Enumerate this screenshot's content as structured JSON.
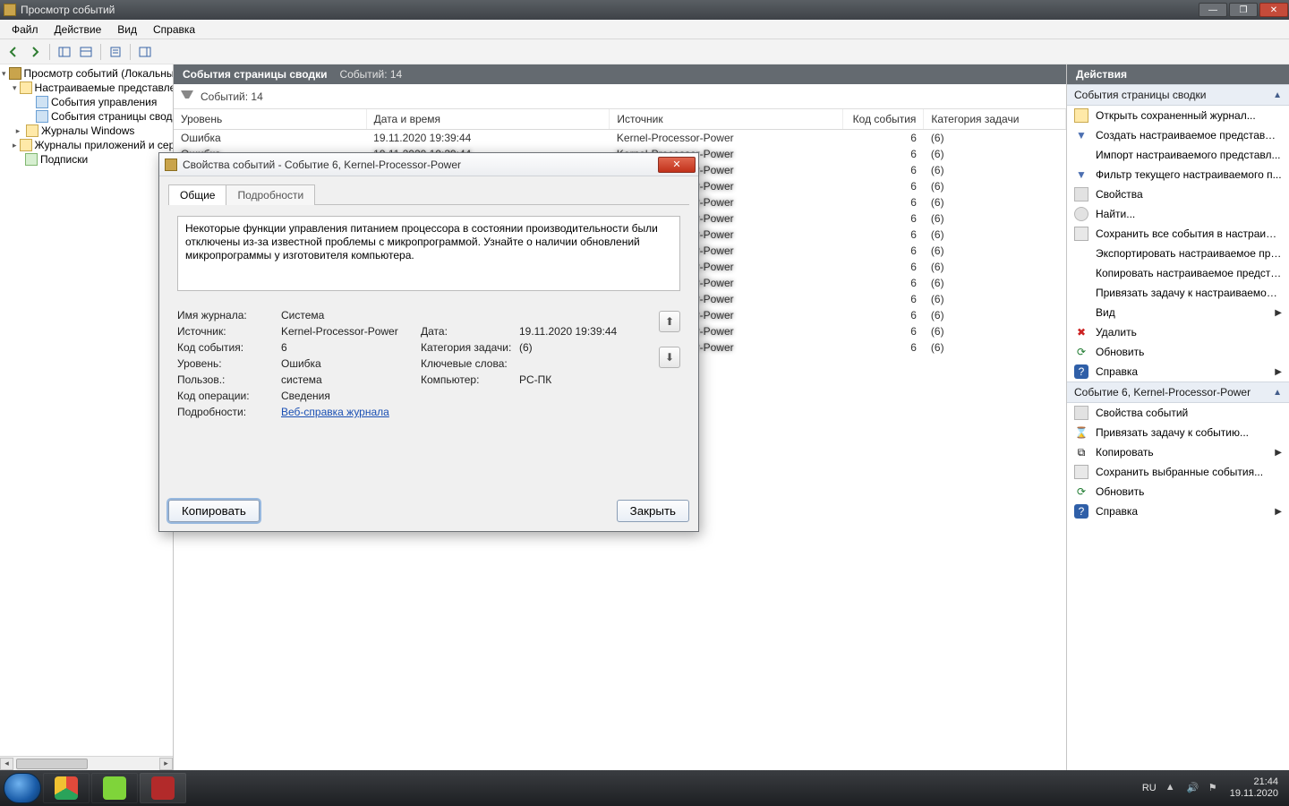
{
  "window": {
    "title": "Просмотр событий"
  },
  "menus": {
    "file": "Файл",
    "action": "Действие",
    "view": "Вид",
    "help": "Справка"
  },
  "tree": {
    "root": "Просмотр событий (Локальный)",
    "custom_views": "Настраиваемые представления",
    "admin_events": "События управления",
    "summary_events": "События страницы сводки",
    "windows_logs": "Журналы Windows",
    "app_logs": "Журналы приложений и сервисов",
    "subscriptions": "Подписки"
  },
  "center": {
    "section_title": "События страницы сводки",
    "events_count_hdr": "Событий: 14",
    "filter_label": "Событий: 14",
    "columns": {
      "level": "Уровень",
      "date": "Дата и время",
      "source": "Источник",
      "code": "Код события",
      "category": "Категория задачи"
    },
    "rows": [
      {
        "level": "Ошибка",
        "date": "19.11.2020 19:39:44",
        "source": "Kernel-Processor-Power",
        "code": "6",
        "category": "(6)"
      },
      {
        "level": "",
        "date": "",
        "source": "",
        "code": "6",
        "category": "(6)"
      },
      {
        "level": "",
        "date": "",
        "source": "",
        "code": "6",
        "category": "(6)"
      },
      {
        "level": "",
        "date": "",
        "source": "",
        "code": "6",
        "category": "(6)"
      },
      {
        "level": "",
        "date": "",
        "source": "",
        "code": "6",
        "category": "(6)"
      },
      {
        "level": "",
        "date": "",
        "source": "",
        "code": "6",
        "category": "(6)"
      },
      {
        "level": "",
        "date": "",
        "source": "",
        "code": "6",
        "category": "(6)"
      },
      {
        "level": "",
        "date": "",
        "source": "",
        "code": "6",
        "category": "(6)"
      },
      {
        "level": "",
        "date": "",
        "source": "",
        "code": "6",
        "category": "(6)"
      },
      {
        "level": "",
        "date": "",
        "source": "",
        "code": "6",
        "category": "(6)"
      },
      {
        "level": "",
        "date": "",
        "source": "",
        "code": "6",
        "category": "(6)"
      },
      {
        "level": "",
        "date": "",
        "source": "",
        "code": "6",
        "category": "(6)"
      },
      {
        "level": "",
        "date": "",
        "source": "",
        "code": "6",
        "category": "(6)"
      },
      {
        "level": "",
        "date": "",
        "source": "",
        "code": "6",
        "category": "(6)"
      }
    ]
  },
  "actions": {
    "title": "Действия",
    "section1": {
      "header": "События страницы сводки",
      "open_log": "Открыть сохраненный журнал...",
      "create_view": "Создать настраиваемое представле...",
      "import_view": "Импорт настраиваемого представл...",
      "filter_view": "Фильтр текущего настраиваемого п...",
      "properties": "Свойства",
      "find": "Найти...",
      "save_all": "Сохранить все события в настраива...",
      "export_view": "Экспортировать настраиваемое пре...",
      "copy_view": "Копировать настраиваемое предста...",
      "attach_task_view": "Привязать задачу к настраиваемом...",
      "view": "Вид",
      "delete": "Удалить",
      "refresh": "Обновить",
      "help": "Справка"
    },
    "section2": {
      "header": "Событие 6, Kernel-Processor-Power",
      "event_props": "Свойства событий",
      "attach_task_event": "Привязать задачу к событию...",
      "copy": "Копировать",
      "save_selected": "Сохранить выбранные события...",
      "refresh": "Обновить",
      "help": "Справка"
    }
  },
  "dialog": {
    "title": "Свойства событий - Событие 6, Kernel-Processor-Power",
    "tab_general": "Общие",
    "tab_details": "Подробности",
    "description": "Некоторые функции управления питанием процессора в состоянии производительности были отключены из-за известной проблемы с микропрограммой. Узнайте о наличии обновлений микропрограммы у изготовителя компьютера.",
    "labels": {
      "log_name": "Имя журнала:",
      "source": "Источник:",
      "event_id": "Код события:",
      "level": "Уровень:",
      "user": "Пользов.:",
      "opcode": "Код операции:",
      "more_info": "Подробности:",
      "date": "Дата:",
      "task_cat": "Категория задачи:",
      "keywords": "Ключевые слова:",
      "computer": "Компьютер:"
    },
    "values": {
      "log_name": "Система",
      "source": "Kernel-Processor-Power",
      "event_id": "6",
      "level": "Ошибка",
      "user": "система",
      "opcode": "Сведения",
      "date": "19.11.2020 19:39:44",
      "task_cat": "(6)",
      "keywords": "",
      "computer": "PC-ПК",
      "help_link": "Веб-справка журнала "
    },
    "buttons": {
      "copy": "Копировать",
      "close": "Закрыть"
    }
  },
  "taskbar": {
    "lang": "RU",
    "time": "21:44",
    "date": "19.11.2020"
  }
}
